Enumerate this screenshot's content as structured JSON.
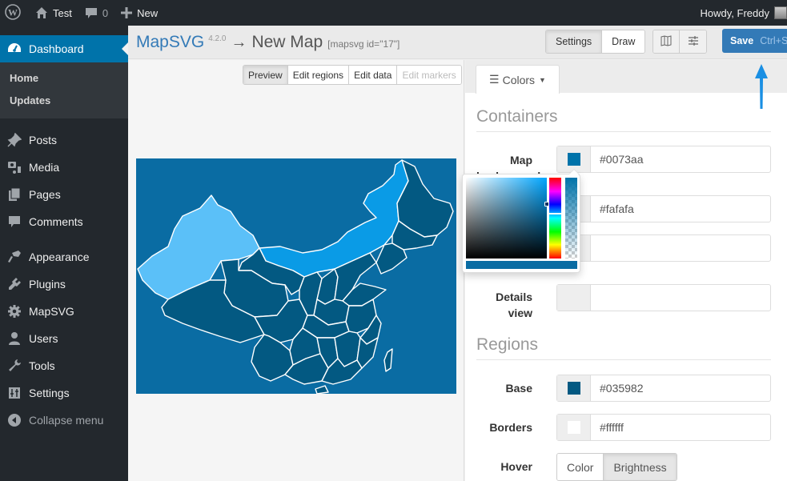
{
  "adminbar": {
    "site_name": "Test",
    "comments_count": "0",
    "new_label": "New",
    "greeting": "Howdy, Freddy",
    "icons": [
      "wordpress-logo-icon",
      "home-icon",
      "comment-icon",
      "plus-icon",
      "avatar"
    ]
  },
  "sidebar": {
    "active": {
      "label": "Dashboard",
      "icon": "dashboard-icon"
    },
    "submenu": [
      {
        "label": "Home"
      },
      {
        "label": "Updates"
      }
    ],
    "items": [
      {
        "label": "Posts",
        "icon": "pin-icon"
      },
      {
        "label": "Media",
        "icon": "media-icon"
      },
      {
        "label": "Pages",
        "icon": "pages-icon"
      },
      {
        "label": "Comments",
        "icon": "comment-icon"
      },
      {
        "label": "Appearance",
        "icon": "paintbrush-icon"
      },
      {
        "label": "Plugins",
        "icon": "plug-icon"
      },
      {
        "label": "MapSVG",
        "icon": "gear-icon"
      },
      {
        "label": "Users",
        "icon": "user-icon"
      },
      {
        "label": "Tools",
        "icon": "wrench-icon"
      },
      {
        "label": "Settings",
        "icon": "sliders-icon"
      },
      {
        "label": "Collapse menu",
        "icon": "collapse-icon"
      }
    ]
  },
  "header": {
    "brand": "MapSVG",
    "version": "4.2.0",
    "arrow": "→",
    "map_name": "New Map",
    "shortcode": "[mapsvg id=\"17\"]",
    "mode_buttons": [
      {
        "label": "Settings",
        "active": true
      },
      {
        "label": "Draw",
        "active": false
      }
    ],
    "icon_buttons": [
      "map-icon",
      "sliders-icon"
    ],
    "save_label": "Save",
    "save_shortcut": "Ctrl+S"
  },
  "map_panel": {
    "edit_modes": [
      {
        "label": "Preview",
        "state": "active"
      },
      {
        "label": "Edit regions",
        "state": "normal"
      },
      {
        "label": "Edit data",
        "state": "normal"
      },
      {
        "label": "Edit markers",
        "state": "disabled"
      }
    ],
    "map_background": "#0073aa",
    "region_colors": {
      "base": "#035982",
      "highlight_west": "#5bc0f8",
      "highlight_north": "#0a9be6",
      "border": "#ffffff"
    }
  },
  "settings_panel": {
    "tab_label": "Colors",
    "sections": {
      "containers": {
        "title": "Containers",
        "fields": [
          {
            "label": "Map background",
            "value": "#0073aa",
            "swatch": "#0073aa"
          },
          {
            "label": "",
            "value": "#fafafa",
            "swatch": "#fafafa"
          },
          {
            "label": "",
            "value": "",
            "swatch": ""
          },
          {
            "label": "Details view",
            "value": "",
            "swatch": ""
          }
        ]
      },
      "regions": {
        "title": "Regions",
        "fields": [
          {
            "label": "Base",
            "value": "#035982",
            "swatch": "#035982"
          },
          {
            "label": "Borders",
            "value": "#ffffff",
            "swatch": "#ffffff"
          }
        ],
        "hover": {
          "label": "Hover",
          "options": [
            {
              "label": "Color",
              "active": false
            },
            {
              "label": "Brightness",
              "active": true
            }
          ]
        }
      }
    }
  },
  "color_picker": {
    "current": "#0073aa"
  }
}
